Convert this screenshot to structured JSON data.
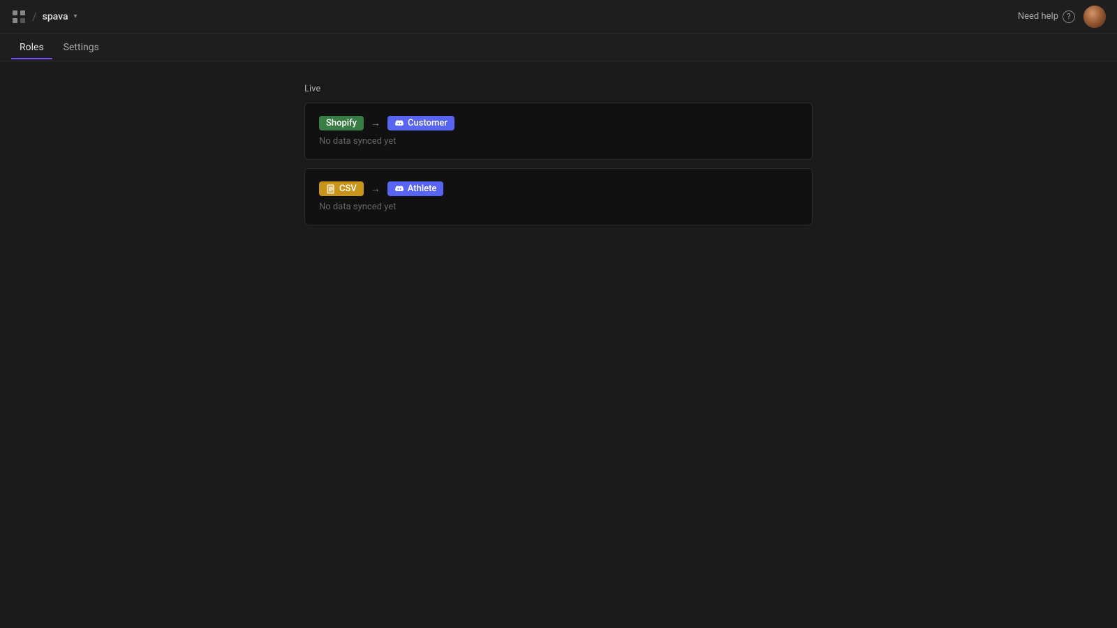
{
  "header": {
    "logo_label": "spava",
    "separator": "/",
    "need_help_label": "Need help",
    "help_icon_char": "?",
    "chevron": "▾"
  },
  "nav": {
    "tabs": [
      {
        "id": "roles",
        "label": "Roles",
        "active": true
      },
      {
        "id": "settings",
        "label": "Settings",
        "active": false
      }
    ]
  },
  "main": {
    "section_label": "Live",
    "sync_cards": [
      {
        "id": "shopify-customer",
        "source_label": "Shopify",
        "source_type": "shopify",
        "arrow": "→",
        "destination_label": "Customer",
        "destination_type": "discord",
        "no_data_text": "No data synced yet"
      },
      {
        "id": "csv-athlete",
        "source_label": "CSV",
        "source_type": "csv",
        "arrow": "→",
        "destination_label": "Athlete",
        "destination_type": "discord",
        "no_data_text": "No data synced yet"
      }
    ]
  }
}
